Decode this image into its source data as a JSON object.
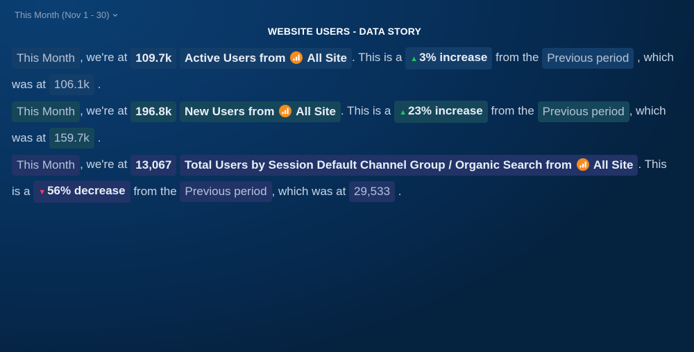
{
  "header": {
    "period_selector": "This Month (Nov 1 - 30)",
    "title": "WEBSITE USERS - DATA STORY"
  },
  "icons": {
    "source_icon": "google-analytics-icon",
    "dropdown_icon": "chevron-down-icon",
    "up_icon": "triangle-up-icon",
    "down_icon": "triangle-down-icon"
  },
  "colors": {
    "increase": "#22c55e",
    "decrease": "#f43f5e",
    "source_icon": "#f68b1e"
  },
  "text": {
    "were_at": ", we're at",
    "from": "from",
    "this_is_a": ". This is a",
    "from_the": "from the",
    "comma": ",",
    "which_was_at": "which was at",
    "comma_which_was_at": ", which was at",
    "period_end": ".",
    "this_is": ". This",
    "is_a": "is a"
  },
  "stories": [
    {
      "period": "This Month",
      "value": "109.7k",
      "metric": "Active Users",
      "source": "All Site",
      "change": "3% increase",
      "direction": "up",
      "comparison": "Previous period",
      "previous_value": "106.1k"
    },
    {
      "period": "This Month",
      "value": "196.8k",
      "metric": "New Users",
      "source": "All Site",
      "change": "23% increase",
      "direction": "up",
      "comparison": "Previous period",
      "previous_value": "159.7k"
    },
    {
      "period": "This Month",
      "value": "13,067",
      "metric": "Total Users by Session Default Channel Group / Organic Search",
      "source": "All Site",
      "change": "56% decrease",
      "direction": "down",
      "comparison": "Previous period",
      "previous_value": "29,533"
    }
  ]
}
